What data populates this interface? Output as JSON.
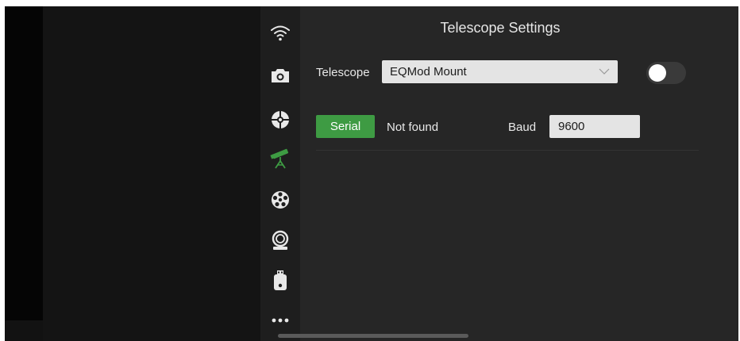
{
  "panel": {
    "title": "Telescope Settings"
  },
  "telescope": {
    "label": "Telescope",
    "selected": "EQMod Mount",
    "connected": false
  },
  "port": {
    "button_label": "Serial",
    "status": "Not found"
  },
  "baud": {
    "label": "Baud",
    "value": "9600"
  },
  "sidebar": {
    "items": [
      {
        "icon": "wifi-icon",
        "active": false
      },
      {
        "icon": "camera-icon",
        "active": false
      },
      {
        "icon": "guider-icon",
        "active": false
      },
      {
        "icon": "telescope-icon",
        "active": true
      },
      {
        "icon": "filter-wheel-icon",
        "active": false
      },
      {
        "icon": "focuser-icon",
        "active": false
      },
      {
        "icon": "usb-drive-icon",
        "active": false
      },
      {
        "icon": "more-icon",
        "active": false
      }
    ]
  },
  "colors": {
    "accent_green": "#3e9b43",
    "panel_bg": "#262626",
    "rail_bg": "#1e1e1e",
    "field_bg": "#e4e4e4"
  }
}
